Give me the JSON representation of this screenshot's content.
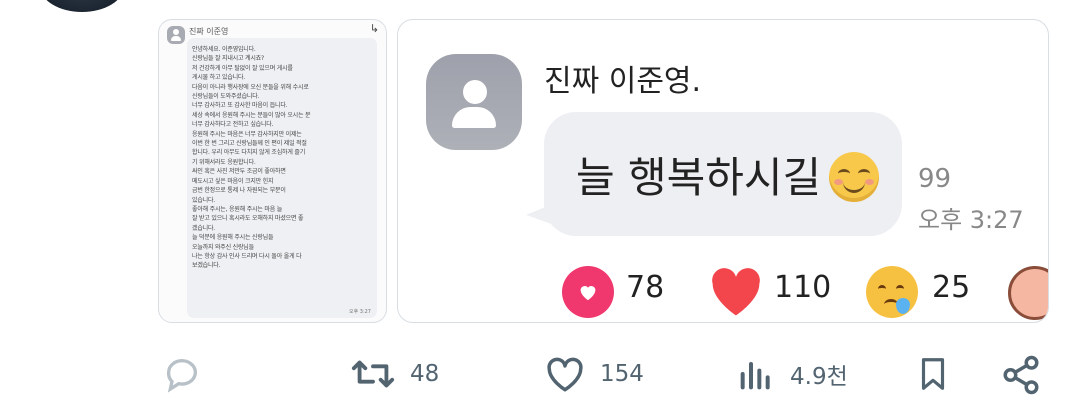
{
  "left_image": {
    "sender_name": "진짜 이준영",
    "message_lines": [
      "안녕하세요. 이준영입니다.",
      "신랑님들 잘 지내시고 계시죠?",
      "저 건강하게 아무 탈없이 잘 있으며 게시를",
      "게시물 하고 있습니다.",
      "다음이 아니라 행사장에 오신 분들을 위해 수시로",
      "신랑님들이 도와주셨습니다.",
      "너무 감사하고 또 감사한 마음이 듭니다.",
      "세상 속에서 응원해 주시는 분들이 많아 오시는 분",
      "너무 감사하다고 전하고 싶습니다.",
      "응원해 주시는 마음은 너무 감사하지만 이제는",
      "이번 한 번 그리고 신랑님들께 인 편이 제일 적절",
      "합니다. 우리 아무도 다치지 않게 조심하게 즐기",
      "기 위해서라도 응원합니다.",
      "싸인 혹은 사진 저만두 조금이 좋아하면",
      "메도시고 싶은 마음이 크지만 힌지",
      "금번 한정으로 통제 나 자원되는 부분이",
      "있습니다.",
      "좋아해 주시는, 응원해 주시는 마음 늘",
      "잘 받고 있으니 혹시라도 오해하지 마셨으면 좋",
      "겠습니다.",
      "늘 덕분에 응원해 주시는 신랑님들",
      "오늘까지 와주신 신랑님들",
      "나는 항상 감사 인사 드리며 다시 돌아 올게 다",
      "보겠습니다."
    ],
    "timestamp": "오후 3:27"
  },
  "right_image": {
    "sender_name": "진짜 이준영.",
    "message": "늘 행복하시길",
    "emoji_icon": "smiling-face-emoji",
    "read_count": "99",
    "timestamp": "오후 3:27",
    "reactions": [
      {
        "icon": "love-reaction-icon",
        "count": "78"
      },
      {
        "icon": "heart-reaction-icon",
        "count": "110"
      },
      {
        "icon": "sad-reaction-icon",
        "count": "25"
      },
      {
        "icon": "peach-character-icon",
        "count": ""
      }
    ]
  },
  "actions": {
    "reply": {
      "icon": "reply-icon",
      "count": ""
    },
    "retweet": {
      "icon": "retweet-icon",
      "count": "48"
    },
    "like": {
      "icon": "like-icon",
      "count": "154"
    },
    "views": {
      "icon": "views-icon",
      "count": "4.9천"
    },
    "bookmark": {
      "icon": "bookmark-icon"
    },
    "share": {
      "icon": "share-icon"
    }
  },
  "colors": {
    "love_reaction": "#f0386e",
    "heart_reaction": "#f2464c",
    "bubble": "#eeeff3",
    "action_icon": "#536471"
  }
}
